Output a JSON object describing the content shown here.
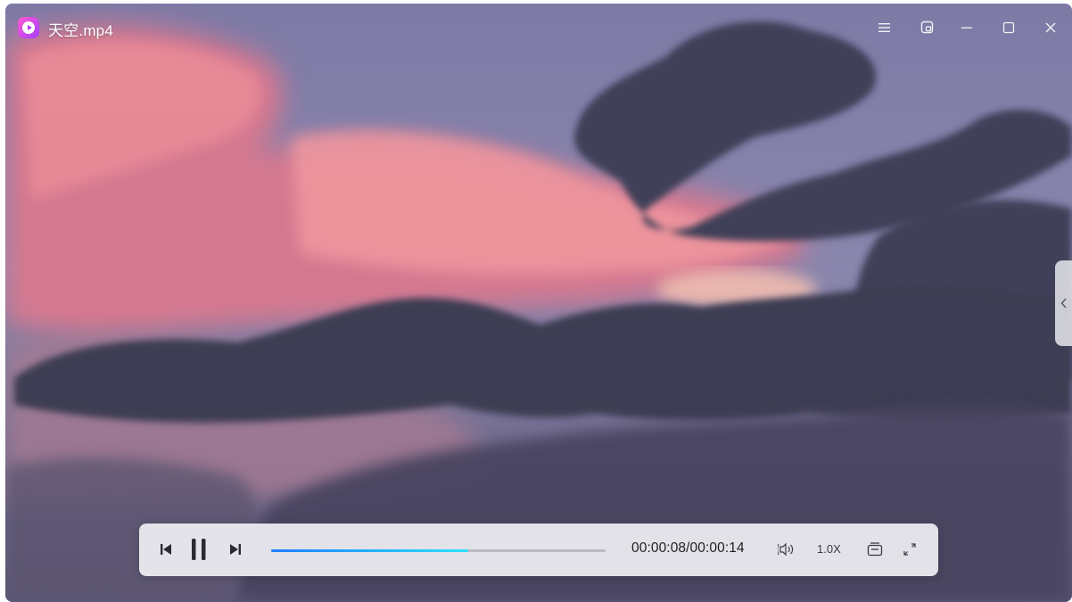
{
  "window": {
    "title": "天空.mp4",
    "app_icon": "video-player-app-icon"
  },
  "titlebar_buttons": [
    {
      "icon": "menu-icon"
    },
    {
      "icon": "mini-mode-icon"
    },
    {
      "icon": "minimize-icon"
    },
    {
      "icon": "maximize-icon"
    },
    {
      "icon": "close-icon"
    }
  ],
  "side_panel": {
    "icon": "chevron-left-icon"
  },
  "player": {
    "time_display": "00:00:08/00:00:14",
    "progress_fraction": 0.59,
    "speed_label": "1.0X",
    "buttons": {
      "previous": "previous-icon",
      "pause": "pause-icon",
      "next": "next-icon",
      "volume": "volume-icon",
      "playlist": "playlist-icon",
      "fullscreen": "fullscreen-icon"
    }
  },
  "colors": {
    "accent": "#25b9ff",
    "control_bar_bg": "#eeeef2"
  }
}
